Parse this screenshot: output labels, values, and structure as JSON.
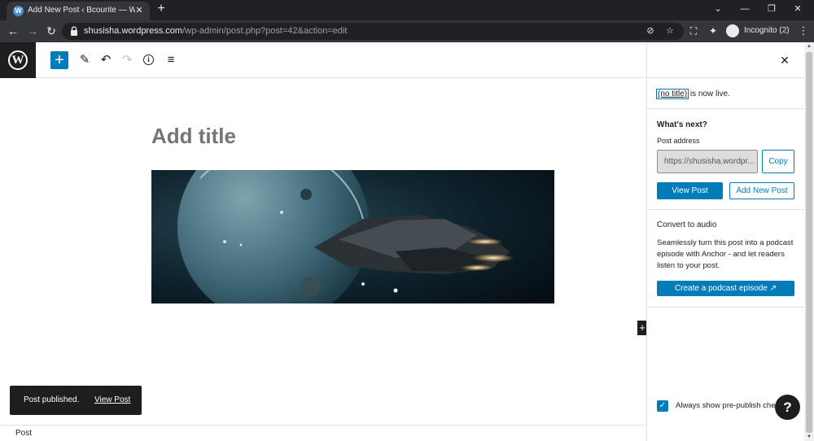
{
  "browser": {
    "tab_title": "Add New Post ‹ Bcourite — WordPress",
    "tab_favicon": "W",
    "tab_close": "✕",
    "new_tab": "+",
    "url_host": "shusisha.wordpress.com",
    "url_path": "/wp-admin/post.php?post=42&action=edit",
    "profile_label": "Incognito (2)",
    "icons": [
      "back-icon",
      "forward-icon",
      "reload-icon",
      "lock-icon",
      "eye-off-icon",
      "star-icon",
      "screenshot-icon",
      "extensions-icon",
      "incognito-icon",
      "menu-icon"
    ]
  },
  "toolbar": {
    "add_block": "+",
    "tools": "✎",
    "undo": "↶",
    "redo": "↷",
    "info": "i",
    "list_view": "≡"
  },
  "editor": {
    "title_placeholder": "Add title",
    "side_inserter": "+",
    "image_description": "space battleship near planet"
  },
  "snackbar": {
    "message": "Post published.",
    "link": "View Post"
  },
  "footer": {
    "breadcrumb": "Post"
  },
  "sidebar": {
    "close": "✕",
    "live_link": "(no title)",
    "live_suffix": " is now live.",
    "whats_next": "What's next?",
    "post_address_label": "Post address",
    "post_address_value": "https://shusisha.wordpr...",
    "copy_button": "Copy",
    "view_post_button": "View Post",
    "add_new_post_button": "Add New Post",
    "convert_heading": "Convert to audio",
    "convert_desc": "Seamlessly turn this post into a podcast episode with Anchor - and let readers listen to your post.",
    "podcast_button": "Create a podcast episode ↗",
    "prepublish_check": "Always show pre-publish checks.",
    "prepublish_checked": true,
    "help": "?"
  },
  "colors": {
    "accent": "#007cba",
    "dark": "#1e1e1e",
    "chrome_dark": "#202124",
    "chrome_toolbar": "#35363a"
  }
}
